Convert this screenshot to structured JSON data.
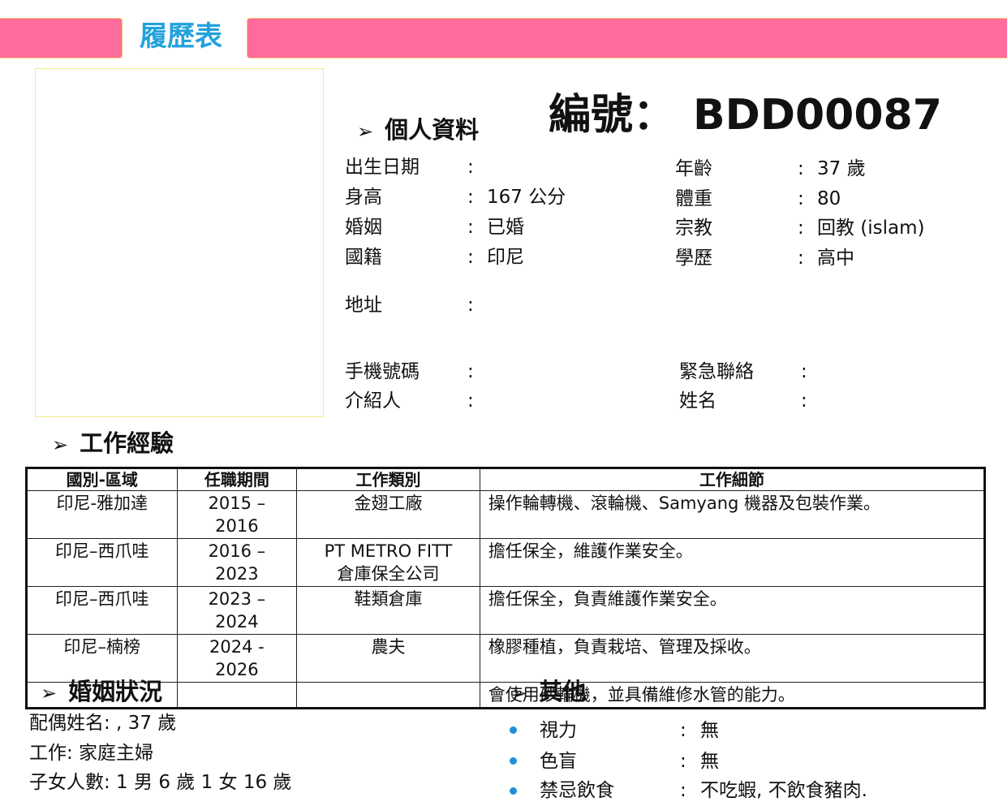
{
  "header": {
    "title": "履歷表"
  },
  "code": {
    "label": "編號：",
    "value": "BDD00087"
  },
  "personal": {
    "heading": "個人資料",
    "left": [
      {
        "label": "出生日期",
        "value": ""
      },
      {
        "label": "身高",
        "value": "167 公分"
      },
      {
        "label": "婚姻",
        "value": "已婚"
      },
      {
        "label": "國籍",
        "value": "印尼"
      }
    ],
    "right": [
      {
        "label": "年齡",
        "value": "37 歲"
      },
      {
        "label": "體重",
        "value": "80"
      },
      {
        "label": "宗教",
        "value": "回教 (islam)"
      },
      {
        "label": "學歷",
        "value": "高中"
      }
    ],
    "address": {
      "label": "地址",
      "value": ""
    },
    "phone": {
      "label": "手機號碼",
      "value": ""
    },
    "referrer": {
      "label": "介紹人",
      "value": ""
    },
    "emergency": {
      "label": "緊急聯絡",
      "value": ""
    },
    "name": {
      "label": "姓名",
      "value": ""
    },
    "colon": ":"
  },
  "work": {
    "heading": "工作經驗",
    "columns": [
      "國別-區域",
      "任職期間",
      "工作類別",
      "工作細節"
    ],
    "rows": [
      {
        "region": "印尼-雅加達",
        "period": "2015 – 2016",
        "type": "金翅工廠",
        "type2": "",
        "detail": "操作輪轉機、滾輪機、Samyang 機器及包裝作業。"
      },
      {
        "region": "印尼–西爪哇",
        "period": "2016 – 2023",
        "type": "PT METRO FITT",
        "type2": "倉庫保全公司",
        "detail": "擔任保全，維護作業安全。"
      },
      {
        "region": "印尼–西爪哇",
        "period": "2023 – 2024",
        "type": "鞋類倉庫",
        "type2": "",
        "detail": "擔任保全，負責維護作業安全。"
      },
      {
        "region": "印尼–楠榜",
        "period": "2024 - 2026",
        "type": "農夫",
        "type2": "",
        "detail": "橡膠種植，負責栽培、管理及採收。"
      },
      {
        "region": "",
        "period": "",
        "type": "",
        "type2": "",
        "detail": "會使用砂輪機，並具備維修水管的能力。"
      }
    ]
  },
  "marriage": {
    "heading": "婚姻狀況",
    "spouse": "配偶姓名: , 37 歲",
    "job": "工作:  家庭主婦",
    "children": "子女人數:  1 男 6 歲  1 女 16 歲"
  },
  "other": {
    "heading": "其他",
    "items": [
      {
        "label": "視力",
        "value": "無"
      },
      {
        "label": "色盲",
        "value": "無"
      },
      {
        "label": "禁忌飲食",
        "value": "不吃蝦, 不飲食豬肉."
      }
    ]
  }
}
